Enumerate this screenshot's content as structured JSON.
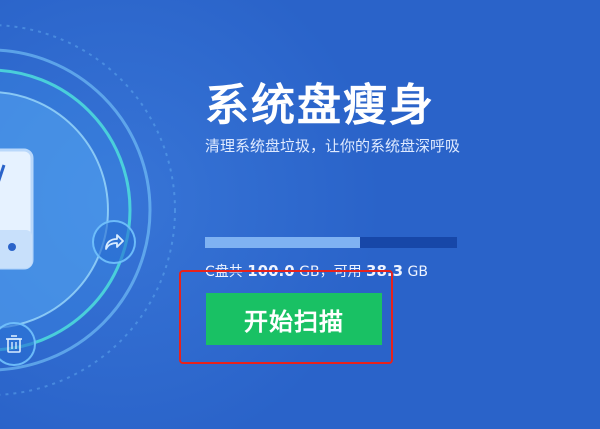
{
  "header": {
    "title": "系统盘瘦身",
    "subtitle": "清理系统盘垃圾，让你的系统盘深呼吸"
  },
  "disk": {
    "used_fraction": 0.617,
    "label_total_prefix": "C盘共",
    "total": "100.0",
    "label_unit1": "GB，可用",
    "available": "38.3",
    "label_unit2": "GB"
  },
  "actions": {
    "start_label": "开始扫描"
  },
  "icons": {
    "disk": "hard-disk-icon",
    "share": "share-arrow-icon",
    "trash": "trash-icon"
  },
  "colors": {
    "background": "#2a63c9",
    "progress_fill": "#7fb2f2",
    "progress_track": "#1747a8",
    "start_button": "#19c164",
    "highlight": "#e8221b"
  }
}
